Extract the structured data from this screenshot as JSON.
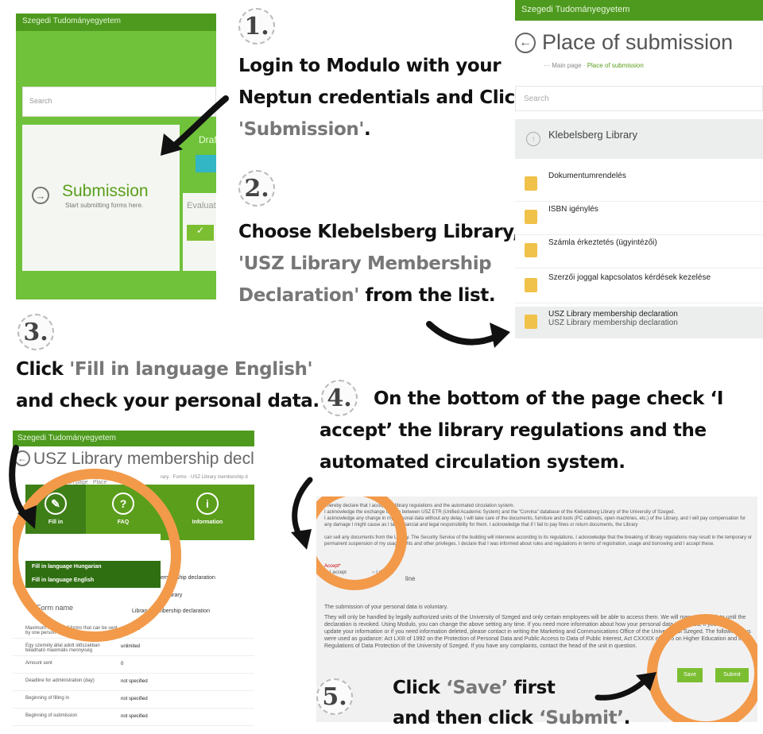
{
  "steps": {
    "s1": {
      "number": "1.",
      "text_a": "Login to Modulo with your",
      "text_b": "Neptun credentials and Click",
      "text_c": "'Submission'",
      "text_d": "."
    },
    "s2": {
      "number": "2.",
      "text_a": "Choose Klebelsberg Library,",
      "text_b": "'USZ Library Membership",
      "text_c": "Declaration'",
      "text_d": " from the list."
    },
    "s3": {
      "number": "3.",
      "text_a": "Click ",
      "text_b": "'Fill in language English'",
      "text_c": "and check your personal data."
    },
    "s4": {
      "number": "4.",
      "text_a": "On the bottom of the page check ‘I",
      "text_b": "accept’ the library regulations and the",
      "text_c": "automated circulation system."
    },
    "s5": {
      "number": "5.",
      "text_a": "Click ",
      "text_b": "‘Save’",
      "text_c": " first",
      "text_d": "and then click ",
      "text_e": "‘Submit’",
      "text_f": "."
    }
  },
  "shot1": {
    "header": "Szegedi Tudományegyetem",
    "search_placeholder": "Search",
    "tile_title": "Submission",
    "tile_sub": "Start submitting forms here.",
    "tile2_a": "Draft",
    "tile2_b": "Evaluated"
  },
  "shot2": {
    "header": "Szegedi Tudományegyetem",
    "title": "Place of submission",
    "crumb_main": "Main page",
    "crumb_sep": " · ",
    "crumb_current": "Place of submission",
    "search_placeholder": "Search",
    "library": "Klebelsberg Library",
    "items": [
      "Dokumentumrendelés",
      "ISBN igénylés",
      "Számla érkeztetés (ügyintézői)",
      "Szerzői joggal kapcsolatos kérdések kezelése"
    ],
    "selected_title": "USZ Library membership declaration",
    "selected_sub": "USZ Library membership declaration"
  },
  "shot3": {
    "header": "Szegedi Tudományegyetem",
    "title": "USZ Library membership decla",
    "crumb": "Main page · Place",
    "crumb_right": "rary · Forms · USZ Library membership d",
    "box_fill": "Fill in",
    "box_faq": "FAQ",
    "box_info": "Information",
    "menu_hu": "Fill in language Hungarian",
    "menu_en": "Fill in language English",
    "partial_1": "embership declaration",
    "partial_2": "g Library",
    "form_name": "Form name",
    "partial_3": "Library membership declaration",
    "rows": [
      {
        "k": "Maximum number of forms that can be sent by one person",
        "v": "unlimited"
      },
      {
        "k": "Egy személy által adott időszakban beadható maximális mennyiség",
        "v": "unlimited"
      },
      {
        "k": "Amount sent",
        "v": "0"
      },
      {
        "k": "Deadline for administration (day)",
        "v": "not specified"
      },
      {
        "k": "Beginning of filling in",
        "v": "not specified"
      },
      {
        "k": "Beginning of submission",
        "v": "not specified"
      }
    ]
  },
  "shot4": {
    "p1": "I hereby declare that I accept the library regulations and the automated circulation system.",
    "p2": "I acknowledge the exchange of data between USZ ETR (Unified Academic System) and the \"Corvina\" database of the Klebelsberg Library of the University of Szeged.",
    "p3": "I acknowledge any change in my personal data without any delay. I will take care of the documents, furniture and tools (PC cabinets, open machines, etc.) of the Library, and I will pay compensation for any damage I might cause as I take financial and legal responsibility for them. I acknowledge that if I fail to pay fines or return documents, the Library",
    "p4": "can sell any documents from the Library. The Security Service of the building will intervene according to its regulations. I acknowledge that the breaking of library regulations may result in the temporary or permanent suspension of my usage rights and other privileges. I declare that I was informed about rules and regulations in terms of registration, usage and borrowing and I accept these.",
    "accept_label": "Accept*",
    "opt_accept": "I accept",
    "opt_decline": "I decline",
    "decline_partial": "line",
    "submission_q": "The submission of your personal data is voluntary.",
    "p5": "They will only be handled by legally authorized units of the University of Szeged and only certain employees will be able to access them. We will manage your data until the declaration is revoked. Using Modulo, you can change the above setting any time. If you need more information about how your personal data is handled, if you need to update your information or if you need information deleted, please contact in writing the Marketing and Communications Office of the University of Szeged. The following laws were used as guidance: Act LXIII of 1992 on the Protection of Personal Data and Public Access to Data of Public Interest, Act CXXXIX of 2005 on Higher Education and the Regulations of Data Protection of the University of Szeged. If you have any complaints, contact the head of the unit in question.",
    "save": "Save",
    "submit": "Submit"
  },
  "colors": {
    "green": "#5a9e1b",
    "orange": "#f29a4a",
    "dark_green": "#2f6f12"
  }
}
